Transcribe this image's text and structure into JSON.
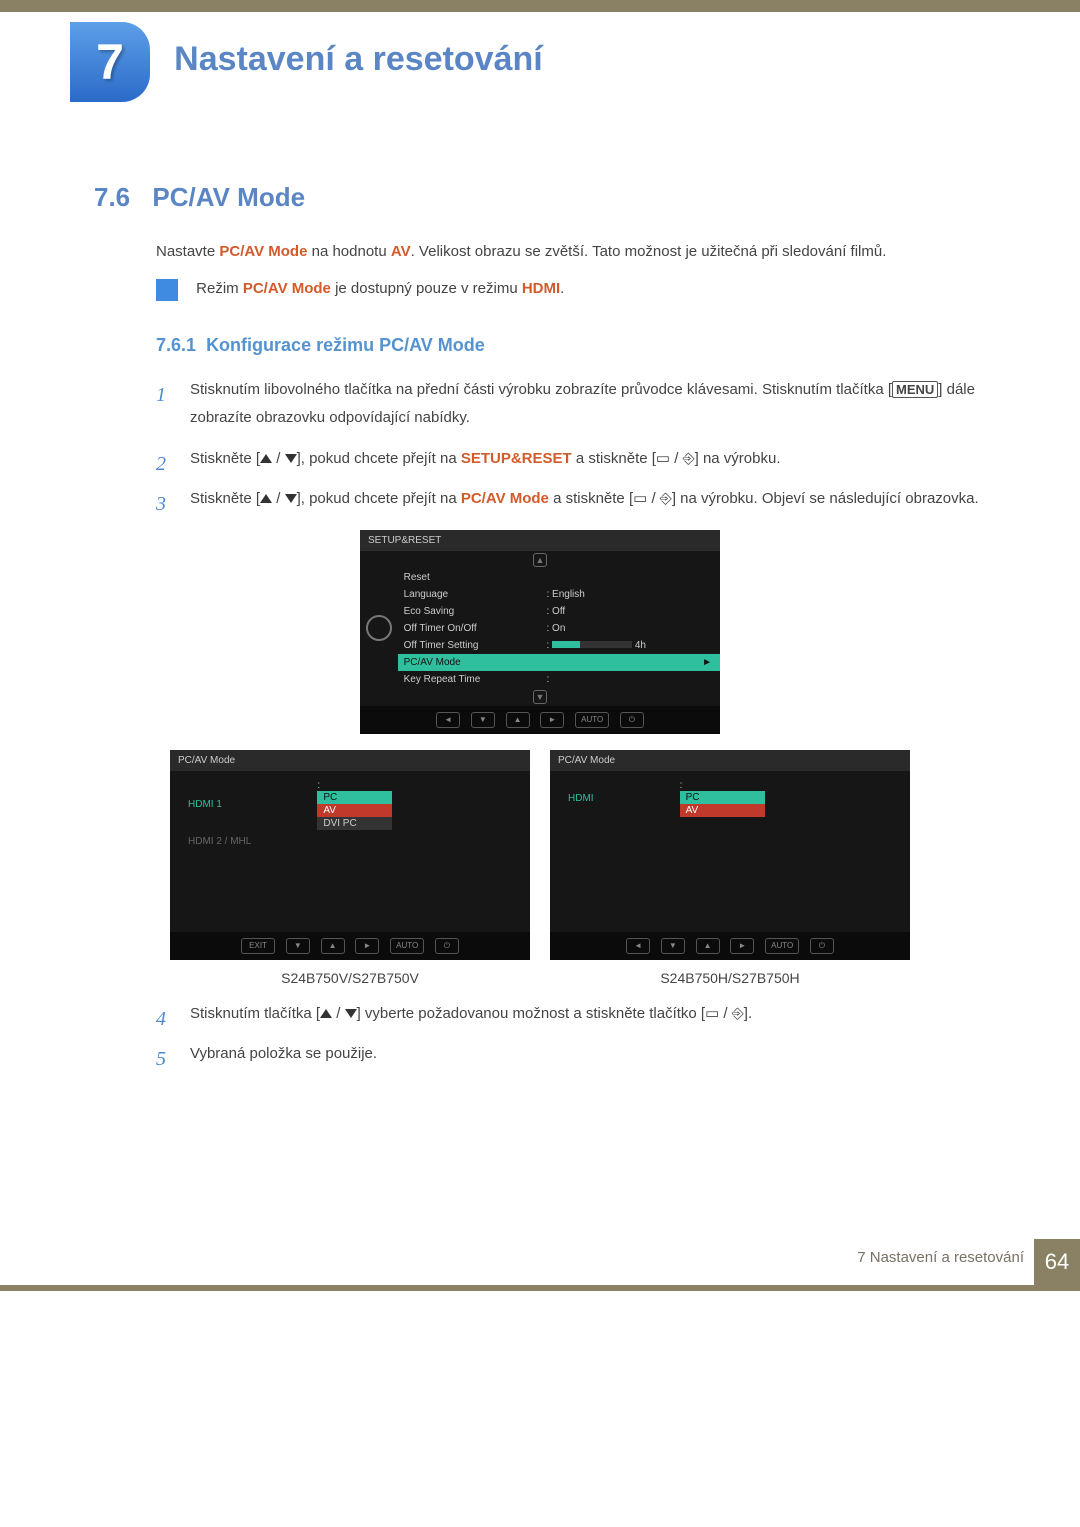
{
  "chapter": {
    "number": "7",
    "title": "Nastavení a resetování"
  },
  "section": {
    "num": "7.6",
    "title": "PC/AV Mode"
  },
  "intro": {
    "t1": "Nastavte ",
    "kw1": "PC/AV Mode",
    "t2": " na hodnotu ",
    "kw2": "AV",
    "t3": ". Velikost obrazu se zvětší. Tato možnost je užitečná při sledování filmů."
  },
  "note": {
    "t1": "Režim ",
    "kw1": "PC/AV Mode",
    "t2": " je dostupný pouze v režimu ",
    "kw2": "HDMI",
    "t3": "."
  },
  "subsection": {
    "num": "7.6.1",
    "title": "Konfigurace režimu PC/AV Mode"
  },
  "steps": {
    "s1": {
      "n": "1",
      "a": "Stisknutím libovolného tlačítka na přední části výrobku zobrazíte průvodce klávesami. Stisknutím tlačítka [",
      "menu": "MENU",
      "b": "] dále zobrazíte obrazovku odpovídající nabídky."
    },
    "s2": {
      "n": "2",
      "a": "Stiskněte [",
      "b": "], pokud chcete přejít na ",
      "kw": "SETUP&RESET",
      "c": " a stiskněte [",
      "d": "] na výrobku."
    },
    "s3": {
      "n": "3",
      "a": "Stiskněte [",
      "b": "], pokud chcete přejít na ",
      "kw": "PC/AV Mode",
      "c": " a stiskněte [",
      "d": "] na výrobku. Objeví se následující obrazovka."
    },
    "s4": {
      "n": "4",
      "a": "Stisknutím tlačítka [",
      "b": "] vyberte požadovanou možnost a stiskněte tlačítko [",
      "c": "]."
    },
    "s5": {
      "n": "5",
      "a": "Vybraná položka se použije."
    }
  },
  "osd_main": {
    "title": "SETUP&RESET",
    "rows": [
      {
        "label": "Reset",
        "val": ""
      },
      {
        "label": "Language",
        "val": "English"
      },
      {
        "label": "Eco Saving",
        "val": "Off"
      },
      {
        "label": "Off Timer On/Off",
        "val": "On"
      },
      {
        "label": "Off Timer Setting",
        "val": "4h"
      },
      {
        "label": "PC/AV Mode",
        "val": ""
      },
      {
        "label": "Key Repeat Time",
        "val": ""
      }
    ],
    "nav": [
      "◄",
      "▼",
      "▲",
      "►",
      "AUTO",
      "⏻"
    ]
  },
  "osd_left": {
    "title": "PC/AV Mode",
    "items": [
      {
        "label": "HDMI 1",
        "cls": "green"
      },
      {
        "label": "HDMI 2 / MHL",
        "cls": "dim"
      }
    ],
    "opts": [
      "PC",
      "AV",
      "DVI PC"
    ],
    "nav": [
      "EXIT",
      "▼",
      "▲",
      "►",
      "AUTO",
      "⏻"
    ],
    "model": "S24B750V/S27B750V"
  },
  "osd_right": {
    "title": "PC/AV Mode",
    "items": [
      {
        "label": "HDMI",
        "cls": "green"
      }
    ],
    "opts": [
      "PC",
      "AV"
    ],
    "nav": [
      "◄",
      "▼",
      "▲",
      "►",
      "AUTO",
      "⏻"
    ],
    "model": "S24B750H/S27B750H"
  },
  "footer": {
    "text": "7 Nastavení a resetování",
    "page": "64"
  }
}
